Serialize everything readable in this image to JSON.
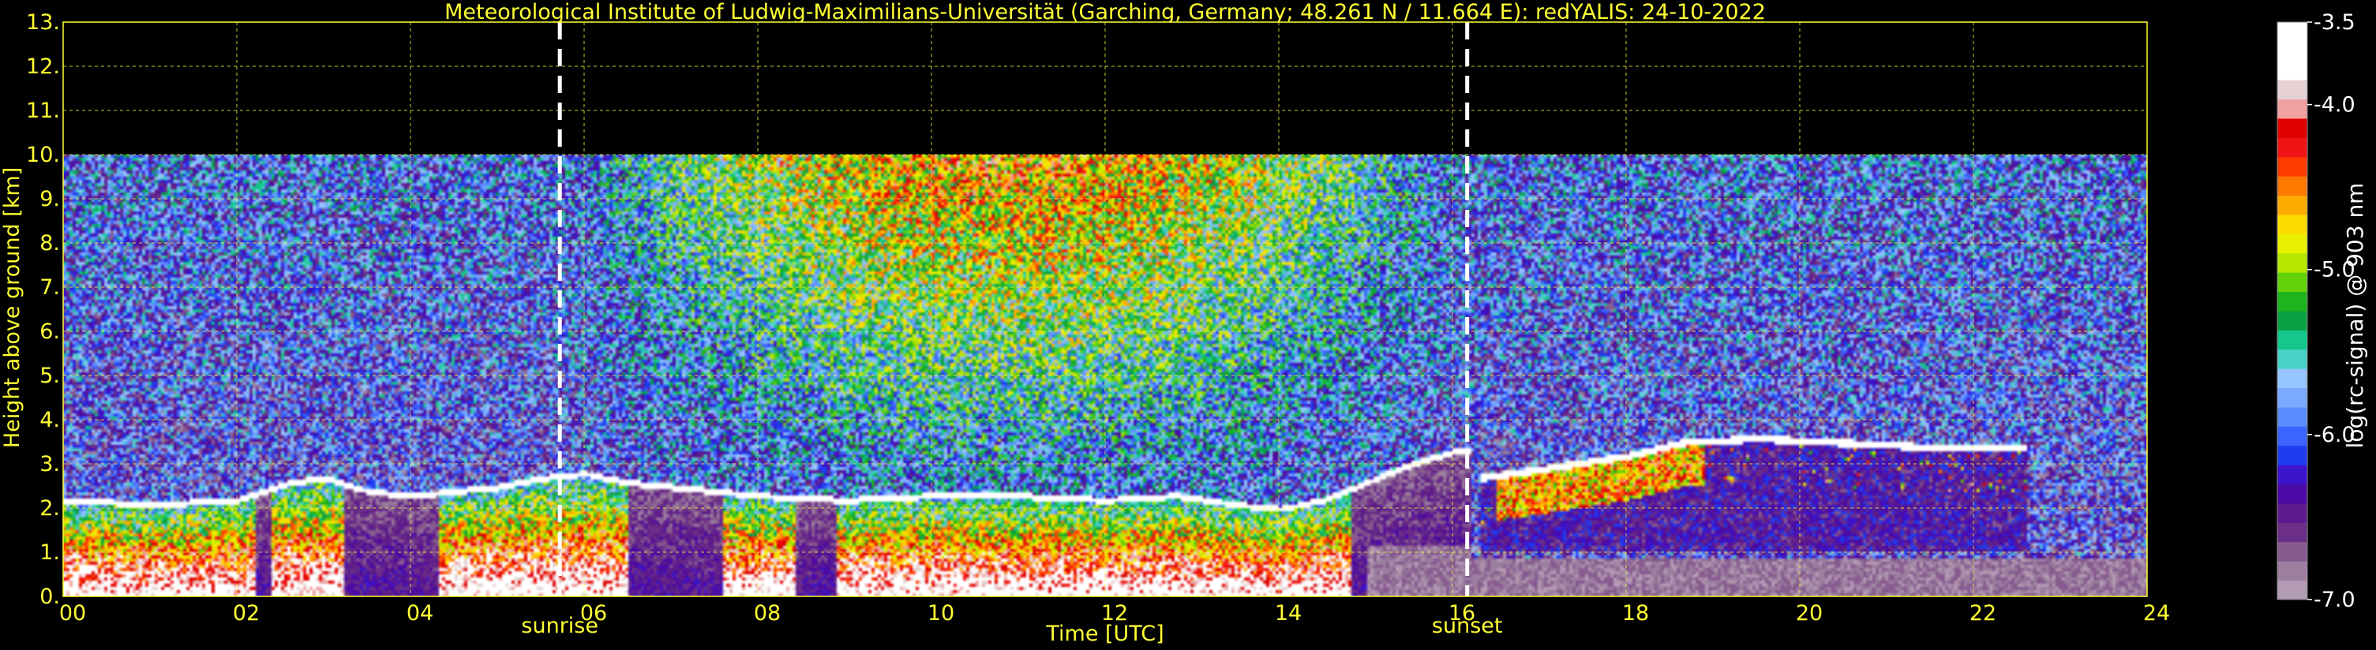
{
  "chart_data": {
    "type": "heatmap",
    "title": "Meteorological Institute of Ludwig-Maximilians-Universität (Garching, Germany; 48.261 N / 11.664 E):    redYALIS: 24-10-2022",
    "xlabel": "Time [UTC]",
    "ylabel": "Height above ground [km]",
    "xlim": [
      0,
      24
    ],
    "ylim": [
      0,
      13
    ],
    "x_ticks": [
      "00",
      "02",
      "04",
      "06",
      "08",
      "10",
      "12",
      "14",
      "16",
      "18",
      "20",
      "22",
      "24"
    ],
    "y_ticks": [
      "0.",
      "1.",
      "2.",
      "3.",
      "4.",
      "5.",
      "6.",
      "7.",
      "8.",
      "9.",
      "10.",
      "11.",
      "12.",
      "13."
    ],
    "grid": true,
    "events": [
      {
        "label": "sunrise",
        "time": 5.72
      },
      {
        "label": "sunset",
        "time": 16.17
      }
    ],
    "data_top_km": 10,
    "colorbar": {
      "label": "log(rc-signal) @ 903 nm",
      "range": [
        -7.0,
        -3.5
      ],
      "ticks": [
        "-3.5",
        "-4.0",
        "-5.0",
        "-6.0",
        "-7.0"
      ],
      "tick_values": [
        -3.5,
        -4.0,
        -5.0,
        -6.0,
        -7.0
      ],
      "colors": [
        "#b49bb4",
        "#9c7f9f",
        "#875b8f",
        "#6c2f87",
        "#5d1a8c",
        "#4b0aa5",
        "#3c14cc",
        "#1e3cf0",
        "#3c64ff",
        "#5a8cff",
        "#7aaaff",
        "#96c4ff",
        "#4bd2c8",
        "#14c88c",
        "#0aa046",
        "#1eb41e",
        "#64d20a",
        "#b4e600",
        "#e6f000",
        "#ffdc00",
        "#ffaa00",
        "#ff7800",
        "#ff3c00",
        "#f01414",
        "#e00000",
        "#f0a0a0",
        "#e6d2d2",
        "#ffffff",
        "#ffffff",
        "#ffffff"
      ]
    },
    "features": {
      "boundary_layer_top_km": [
        [
          0,
          2.2
        ],
        [
          1,
          2.1
        ],
        [
          2,
          2.2
        ],
        [
          2.6,
          2.6
        ],
        [
          3,
          2.7
        ],
        [
          3.5,
          2.4
        ],
        [
          4,
          2.3
        ],
        [
          4.5,
          2.4
        ],
        [
          5,
          2.5
        ],
        [
          5.5,
          2.7
        ],
        [
          6,
          2.8
        ],
        [
          6.5,
          2.6
        ],
        [
          7,
          2.5
        ],
        [
          8,
          2.3
        ],
        [
          9,
          2.2
        ],
        [
          10,
          2.3
        ],
        [
          11,
          2.3
        ],
        [
          12,
          2.2
        ],
        [
          12.8,
          2.3
        ],
        [
          13.5,
          2.1
        ],
        [
          14,
          2.0
        ],
        [
          14.5,
          2.2
        ],
        [
          15,
          2.6
        ],
        [
          15.5,
          3.0
        ],
        [
          16,
          3.3
        ]
      ],
      "elevated_layer_km": [
        [
          16.3,
          2.7
        ],
        [
          17,
          2.9
        ],
        [
          18,
          3.2
        ],
        [
          18.6,
          3.5
        ],
        [
          19.5,
          3.6
        ],
        [
          20.5,
          3.5
        ],
        [
          21.5,
          3.4
        ],
        [
          22.5,
          3.4
        ]
      ],
      "strong_aerosol_segments": [
        [
          0,
          2.2
        ],
        [
          2.4,
          3.2
        ],
        [
          4.3,
          6.5
        ],
        [
          7.6,
          8.4
        ],
        [
          8.9,
          14.8
        ]
      ]
    }
  }
}
